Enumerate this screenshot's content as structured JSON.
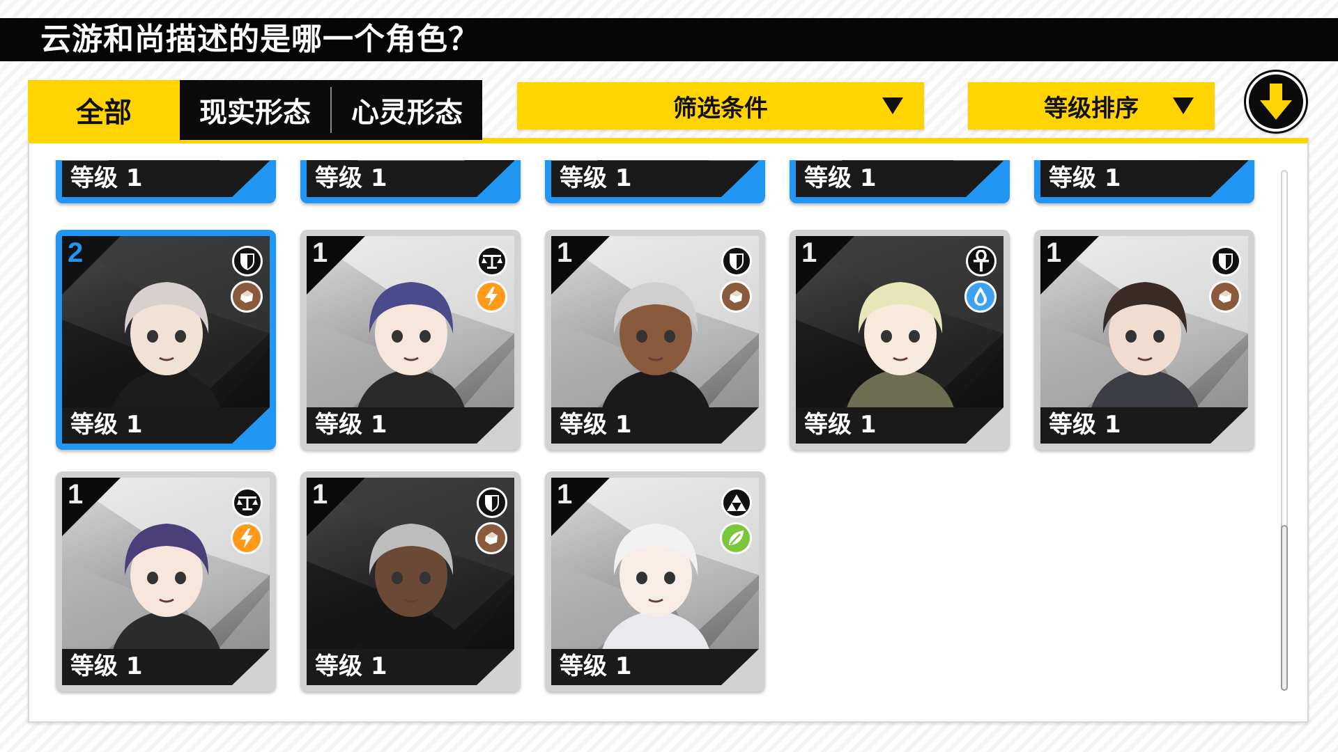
{
  "question": {
    "text": "云游和尚描述的是哪一个角色？"
  },
  "tabs": [
    {
      "label": "全部"
    },
    {
      "label": "现实形态"
    },
    {
      "label": "心灵形态"
    }
  ],
  "filter": {
    "label": "筛选条件"
  },
  "sort": {
    "label": "等级排序"
  },
  "colors": {
    "accent_yellow": "#ffd400",
    "selected_blue": "#2196f3",
    "card_gray": "#d2d2d2",
    "electric_orange": "#ff9a1a",
    "water_blue": "#3ea2f0",
    "nature_green": "#7cc63a",
    "earth_brown": "#8a5a3c"
  },
  "partial_row": [
    {
      "level": "等级 1"
    },
    {
      "level": "等级 1"
    },
    {
      "level": "等级 1"
    },
    {
      "level": "等级 1"
    },
    {
      "level": "等级 1"
    }
  ],
  "characters": [
    {
      "rarity": "2",
      "level": "等级 1",
      "role_icon": "shield-icon",
      "attribute_icon": "earth-icon",
      "selected": true
    },
    {
      "rarity": "1",
      "level": "等级 1",
      "role_icon": "scales-icon",
      "attribute_icon": "lightning-icon",
      "selected": false
    },
    {
      "rarity": "1",
      "level": "等级 1",
      "role_icon": "shield-icon",
      "attribute_icon": "earth-icon",
      "selected": false
    },
    {
      "rarity": "1",
      "level": "等级 1",
      "role_icon": "ankh-icon",
      "attribute_icon": "water-icon",
      "selected": false
    },
    {
      "rarity": "1",
      "level": "等级 1",
      "role_icon": "shield-icon",
      "attribute_icon": "earth-icon",
      "selected": false
    },
    {
      "rarity": "1",
      "level": "等级 1",
      "role_icon": "scales-icon",
      "attribute_icon": "lightning-icon",
      "selected": false
    },
    {
      "rarity": "1",
      "level": "等级 1",
      "role_icon": "shield-icon",
      "attribute_icon": "earth-icon",
      "selected": false
    },
    {
      "rarity": "1",
      "level": "等级 1",
      "role_icon": "triforce-icon",
      "attribute_icon": "leaf-icon",
      "selected": false
    }
  ]
}
